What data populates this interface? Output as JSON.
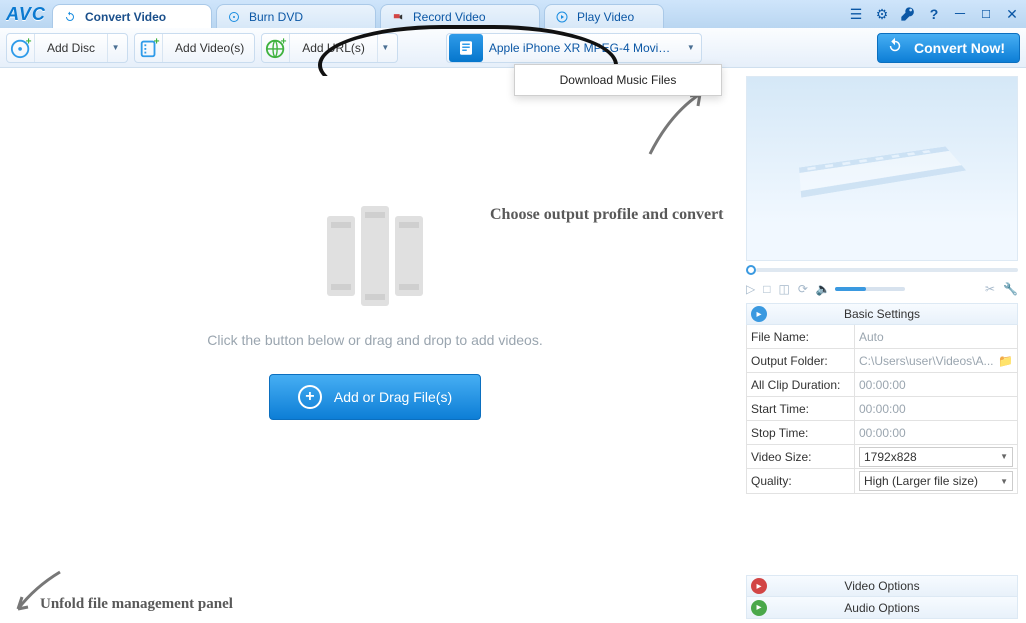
{
  "app": {
    "logo": "AVC"
  },
  "tabs": [
    {
      "label": "Convert Video",
      "icon": "refresh",
      "active": true
    },
    {
      "label": "Burn DVD",
      "icon": "disc",
      "active": false
    },
    {
      "label": "Record Video",
      "icon": "camera",
      "active": false
    },
    {
      "label": "Play Video",
      "icon": "play",
      "active": false
    }
  ],
  "toolbar": {
    "add_disc": "Add Disc",
    "add_videos": "Add Video(s)",
    "add_urls": "Add URL(s)",
    "profile": "Apple iPhone XR MPEG-4 Movie (*.m...",
    "convert": "Convert Now!"
  },
  "url_menu": {
    "item1": "Download Music Files"
  },
  "stage": {
    "hint": "Click the button below or drag and drop to add videos.",
    "add_button": "Add or Drag File(s)"
  },
  "annotations": {
    "choose_profile": "Choose output profile and convert",
    "unfold_panel": "Unfold file management panel"
  },
  "panel": {
    "basic_settings": "Basic Settings",
    "video_options": "Video Options",
    "audio_options": "Audio Options",
    "rows": {
      "file_name": {
        "k": "File Name:",
        "v": "Auto"
      },
      "output_folder": {
        "k": "Output Folder:",
        "v": "C:\\Users\\user\\Videos\\A..."
      },
      "clip_duration": {
        "k": "All Clip Duration:",
        "v": "00:00:00"
      },
      "start_time": {
        "k": "Start Time:",
        "v": "00:00:00"
      },
      "stop_time": {
        "k": "Stop Time:",
        "v": "00:00:00"
      },
      "video_size": {
        "k": "Video Size:",
        "v": "1792x828"
      },
      "quality": {
        "k": "Quality:",
        "v": "High (Larger file size)"
      }
    }
  }
}
